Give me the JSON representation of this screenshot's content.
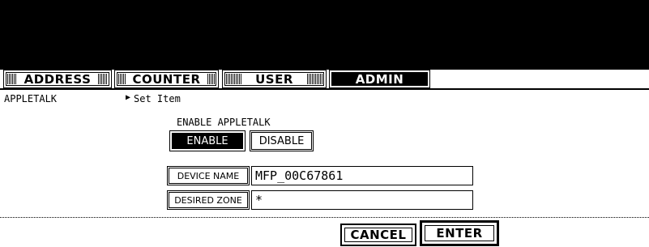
{
  "tabs": [
    {
      "label": "ADDRESS",
      "active": false
    },
    {
      "label": "COUNTER",
      "active": false
    },
    {
      "label": "USER",
      "active": false
    },
    {
      "label": "ADMIN",
      "active": true
    }
  ],
  "breadcrumb": {
    "section": "APPLETALK",
    "arrow": "▶",
    "item": "Set Item"
  },
  "enable_group": {
    "title": "ENABLE APPLETALK",
    "enable_label": "ENABLE",
    "disable_label": "DISABLE",
    "selected": "ENABLE"
  },
  "device_name": {
    "label": "DEVICE NAME",
    "value": "MFP_00C67861"
  },
  "desired_zone": {
    "label": "DESIRED ZONE",
    "value": "*"
  },
  "footer": {
    "cancel_label": "CANCEL",
    "enter_label": "ENTER"
  }
}
